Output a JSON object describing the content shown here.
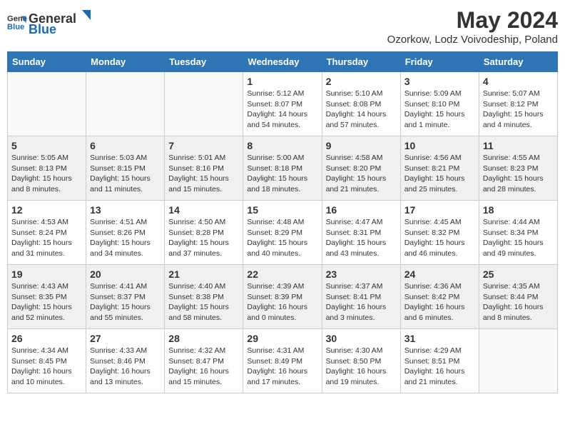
{
  "header": {
    "logo_general": "General",
    "logo_blue": "Blue",
    "title": "May 2024",
    "subtitle": "Ozorkow, Lodz Voivodeship, Poland"
  },
  "days": [
    "Sunday",
    "Monday",
    "Tuesday",
    "Wednesday",
    "Thursday",
    "Friday",
    "Saturday"
  ],
  "weeks": [
    [
      {
        "date": "",
        "sunrise": "",
        "sunset": "",
        "daylight": "",
        "empty": true
      },
      {
        "date": "",
        "sunrise": "",
        "sunset": "",
        "daylight": "",
        "empty": true
      },
      {
        "date": "",
        "sunrise": "",
        "sunset": "",
        "daylight": "",
        "empty": true
      },
      {
        "date": "1",
        "sunrise": "Sunrise: 5:12 AM",
        "sunset": "Sunset: 8:07 PM",
        "daylight": "Daylight: 14 hours and 54 minutes."
      },
      {
        "date": "2",
        "sunrise": "Sunrise: 5:10 AM",
        "sunset": "Sunset: 8:08 PM",
        "daylight": "Daylight: 14 hours and 57 minutes."
      },
      {
        "date": "3",
        "sunrise": "Sunrise: 5:09 AM",
        "sunset": "Sunset: 8:10 PM",
        "daylight": "Daylight: 15 hours and 1 minute."
      },
      {
        "date": "4",
        "sunrise": "Sunrise: 5:07 AM",
        "sunset": "Sunset: 8:12 PM",
        "daylight": "Daylight: 15 hours and 4 minutes."
      }
    ],
    [
      {
        "date": "5",
        "sunrise": "Sunrise: 5:05 AM",
        "sunset": "Sunset: 8:13 PM",
        "daylight": "Daylight: 15 hours and 8 minutes."
      },
      {
        "date": "6",
        "sunrise": "Sunrise: 5:03 AM",
        "sunset": "Sunset: 8:15 PM",
        "daylight": "Daylight: 15 hours and 11 minutes."
      },
      {
        "date": "7",
        "sunrise": "Sunrise: 5:01 AM",
        "sunset": "Sunset: 8:16 PM",
        "daylight": "Daylight: 15 hours and 15 minutes."
      },
      {
        "date": "8",
        "sunrise": "Sunrise: 5:00 AM",
        "sunset": "Sunset: 8:18 PM",
        "daylight": "Daylight: 15 hours and 18 minutes."
      },
      {
        "date": "9",
        "sunrise": "Sunrise: 4:58 AM",
        "sunset": "Sunset: 8:20 PM",
        "daylight": "Daylight: 15 hours and 21 minutes."
      },
      {
        "date": "10",
        "sunrise": "Sunrise: 4:56 AM",
        "sunset": "Sunset: 8:21 PM",
        "daylight": "Daylight: 15 hours and 25 minutes."
      },
      {
        "date": "11",
        "sunrise": "Sunrise: 4:55 AM",
        "sunset": "Sunset: 8:23 PM",
        "daylight": "Daylight: 15 hours and 28 minutes."
      }
    ],
    [
      {
        "date": "12",
        "sunrise": "Sunrise: 4:53 AM",
        "sunset": "Sunset: 8:24 PM",
        "daylight": "Daylight: 15 hours and 31 minutes."
      },
      {
        "date": "13",
        "sunrise": "Sunrise: 4:51 AM",
        "sunset": "Sunset: 8:26 PM",
        "daylight": "Daylight: 15 hours and 34 minutes."
      },
      {
        "date": "14",
        "sunrise": "Sunrise: 4:50 AM",
        "sunset": "Sunset: 8:28 PM",
        "daylight": "Daylight: 15 hours and 37 minutes."
      },
      {
        "date": "15",
        "sunrise": "Sunrise: 4:48 AM",
        "sunset": "Sunset: 8:29 PM",
        "daylight": "Daylight: 15 hours and 40 minutes."
      },
      {
        "date": "16",
        "sunrise": "Sunrise: 4:47 AM",
        "sunset": "Sunset: 8:31 PM",
        "daylight": "Daylight: 15 hours and 43 minutes."
      },
      {
        "date": "17",
        "sunrise": "Sunrise: 4:45 AM",
        "sunset": "Sunset: 8:32 PM",
        "daylight": "Daylight: 15 hours and 46 minutes."
      },
      {
        "date": "18",
        "sunrise": "Sunrise: 4:44 AM",
        "sunset": "Sunset: 8:34 PM",
        "daylight": "Daylight: 15 hours and 49 minutes."
      }
    ],
    [
      {
        "date": "19",
        "sunrise": "Sunrise: 4:43 AM",
        "sunset": "Sunset: 8:35 PM",
        "daylight": "Daylight: 15 hours and 52 minutes."
      },
      {
        "date": "20",
        "sunrise": "Sunrise: 4:41 AM",
        "sunset": "Sunset: 8:37 PM",
        "daylight": "Daylight: 15 hours and 55 minutes."
      },
      {
        "date": "21",
        "sunrise": "Sunrise: 4:40 AM",
        "sunset": "Sunset: 8:38 PM",
        "daylight": "Daylight: 15 hours and 58 minutes."
      },
      {
        "date": "22",
        "sunrise": "Sunrise: 4:39 AM",
        "sunset": "Sunset: 8:39 PM",
        "daylight": "Daylight: 16 hours and 0 minutes."
      },
      {
        "date": "23",
        "sunrise": "Sunrise: 4:37 AM",
        "sunset": "Sunset: 8:41 PM",
        "daylight": "Daylight: 16 hours and 3 minutes."
      },
      {
        "date": "24",
        "sunrise": "Sunrise: 4:36 AM",
        "sunset": "Sunset: 8:42 PM",
        "daylight": "Daylight: 16 hours and 6 minutes."
      },
      {
        "date": "25",
        "sunrise": "Sunrise: 4:35 AM",
        "sunset": "Sunset: 8:44 PM",
        "daylight": "Daylight: 16 hours and 8 minutes."
      }
    ],
    [
      {
        "date": "26",
        "sunrise": "Sunrise: 4:34 AM",
        "sunset": "Sunset: 8:45 PM",
        "daylight": "Daylight: 16 hours and 10 minutes."
      },
      {
        "date": "27",
        "sunrise": "Sunrise: 4:33 AM",
        "sunset": "Sunset: 8:46 PM",
        "daylight": "Daylight: 16 hours and 13 minutes."
      },
      {
        "date": "28",
        "sunrise": "Sunrise: 4:32 AM",
        "sunset": "Sunset: 8:47 PM",
        "daylight": "Daylight: 16 hours and 15 minutes."
      },
      {
        "date": "29",
        "sunrise": "Sunrise: 4:31 AM",
        "sunset": "Sunset: 8:49 PM",
        "daylight": "Daylight: 16 hours and 17 minutes."
      },
      {
        "date": "30",
        "sunrise": "Sunrise: 4:30 AM",
        "sunset": "Sunset: 8:50 PM",
        "daylight": "Daylight: 16 hours and 19 minutes."
      },
      {
        "date": "31",
        "sunrise": "Sunrise: 4:29 AM",
        "sunset": "Sunset: 8:51 PM",
        "daylight": "Daylight: 16 hours and 21 minutes."
      },
      {
        "date": "",
        "sunrise": "",
        "sunset": "",
        "daylight": "",
        "empty": true
      }
    ]
  ]
}
